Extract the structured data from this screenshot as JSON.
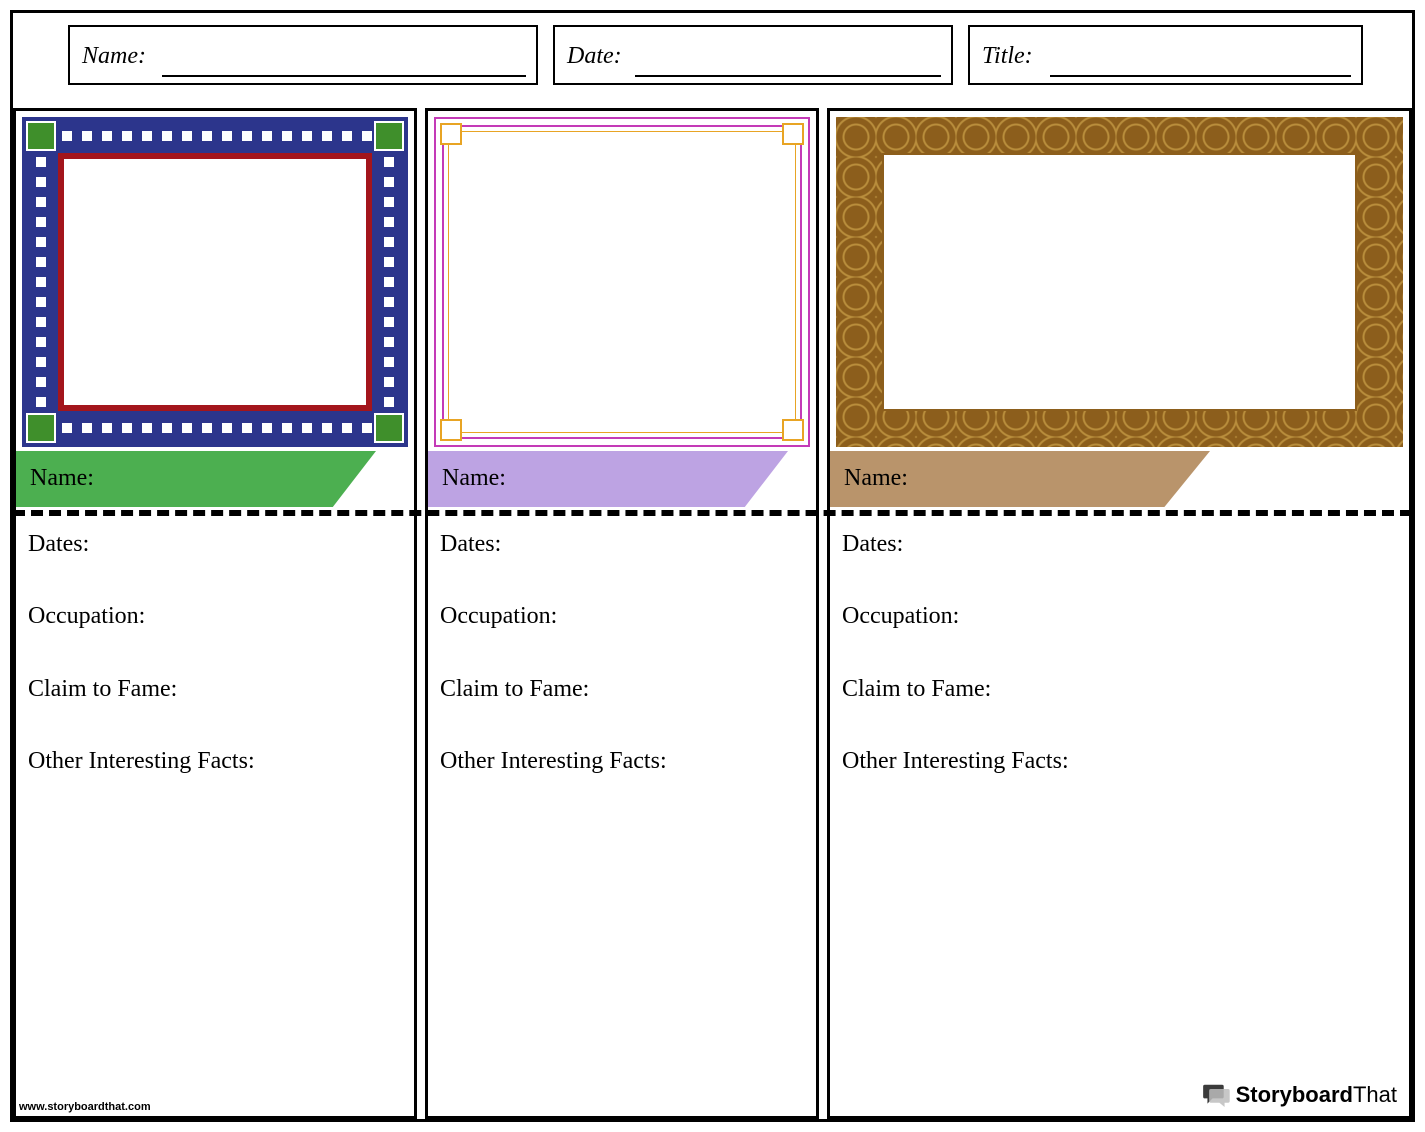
{
  "header": {
    "name_label": "Name:",
    "date_label": "Date:",
    "title_label": "Title:"
  },
  "columns": [
    {
      "name_label": "Name:",
      "frame_color": "#4CAF50",
      "fields": {
        "dates": "Dates:",
        "occupation": "Occupation:",
        "claim": "Claim to Fame:",
        "other": "Other Interesting Facts:"
      }
    },
    {
      "name_label": "Name:",
      "frame_color": "#BDA3E3",
      "fields": {
        "dates": "Dates:",
        "occupation": "Occupation:",
        "claim": "Claim to Fame:",
        "other": "Other Interesting Facts:"
      }
    },
    {
      "name_label": "Name:",
      "frame_color": "#B9946B",
      "fields": {
        "dates": "Dates:",
        "occupation": "Occupation:",
        "claim": "Claim to Fame:",
        "other": "Other Interesting Facts:"
      }
    }
  ],
  "footer": {
    "url": "www.storyboardthat.com",
    "brand_strong": "Storyboard",
    "brand_light": "That"
  }
}
